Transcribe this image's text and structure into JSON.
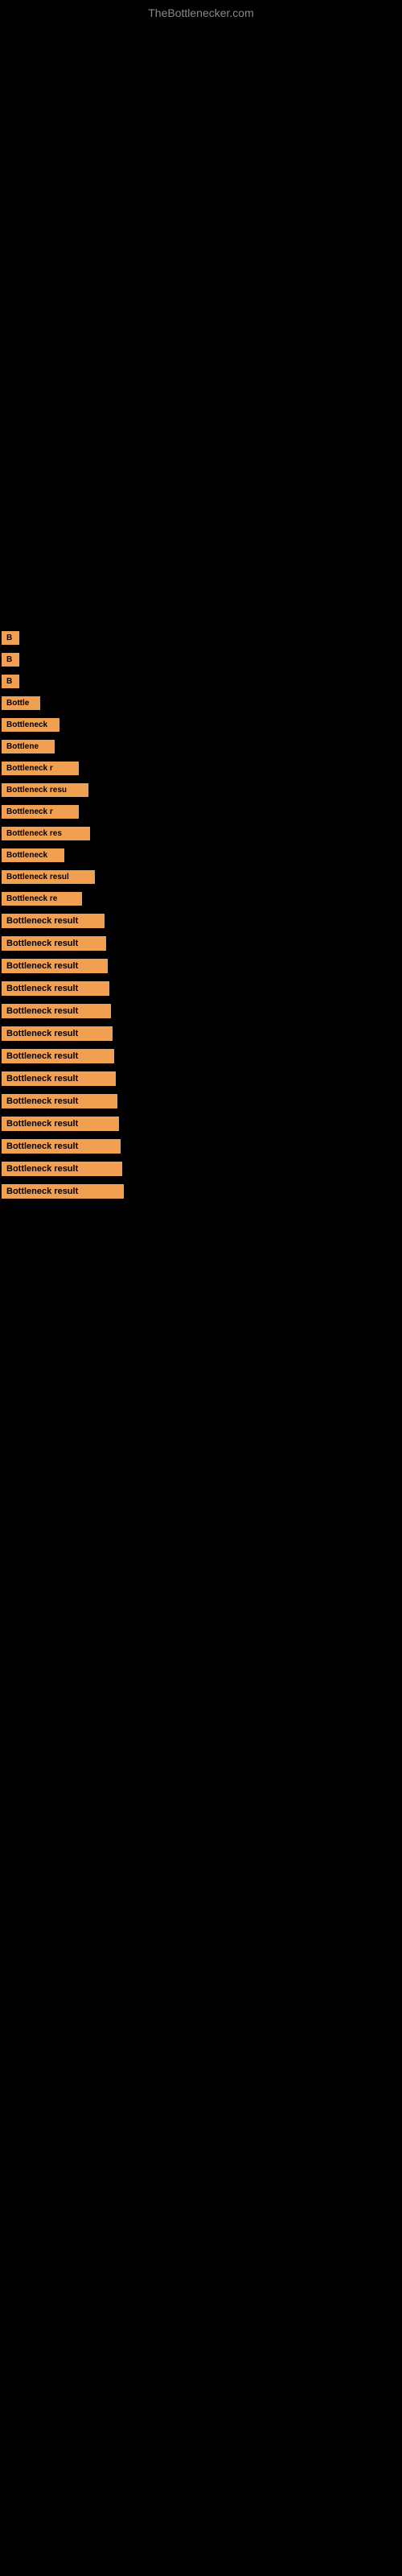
{
  "site": {
    "title": "TheBottlenecker.com"
  },
  "items": [
    {
      "id": 1,
      "label": "B",
      "class": "item-1"
    },
    {
      "id": 2,
      "label": "B",
      "class": "item-2"
    },
    {
      "id": 3,
      "label": "B",
      "class": "item-3"
    },
    {
      "id": 4,
      "label": "Bottle",
      "class": "item-4"
    },
    {
      "id": 5,
      "label": "Bottleneck",
      "class": "item-5"
    },
    {
      "id": 6,
      "label": "Bottlene",
      "class": "item-6"
    },
    {
      "id": 7,
      "label": "Bottleneck r",
      "class": "item-7"
    },
    {
      "id": 8,
      "label": "Bottleneck resu",
      "class": "item-8"
    },
    {
      "id": 9,
      "label": "Bottleneck r",
      "class": "item-9"
    },
    {
      "id": 10,
      "label": "Bottleneck res",
      "class": "item-10"
    },
    {
      "id": 11,
      "label": "Bottleneck",
      "class": "item-11"
    },
    {
      "id": 12,
      "label": "Bottleneck resul",
      "class": "item-12"
    },
    {
      "id": 13,
      "label": "Bottleneck re",
      "class": "item-13"
    },
    {
      "id": 14,
      "label": "Bottleneck result",
      "class": "item-14"
    },
    {
      "id": 15,
      "label": "Bottleneck result",
      "class": "item-15"
    },
    {
      "id": 16,
      "label": "Bottleneck result",
      "class": "item-16"
    },
    {
      "id": 17,
      "label": "Bottleneck result",
      "class": "item-17"
    },
    {
      "id": 18,
      "label": "Bottleneck result",
      "class": "item-18"
    },
    {
      "id": 19,
      "label": "Bottleneck result",
      "class": "item-19"
    },
    {
      "id": 20,
      "label": "Bottleneck result",
      "class": "item-20"
    },
    {
      "id": 21,
      "label": "Bottleneck result",
      "class": "item-21"
    },
    {
      "id": 22,
      "label": "Bottleneck result",
      "class": "item-22"
    },
    {
      "id": 23,
      "label": "Bottleneck result",
      "class": "item-23"
    },
    {
      "id": 24,
      "label": "Bottleneck result",
      "class": "item-24"
    },
    {
      "id": 25,
      "label": "Bottleneck result",
      "class": "item-25"
    },
    {
      "id": 26,
      "label": "Bottleneck result",
      "class": "item-26"
    }
  ]
}
